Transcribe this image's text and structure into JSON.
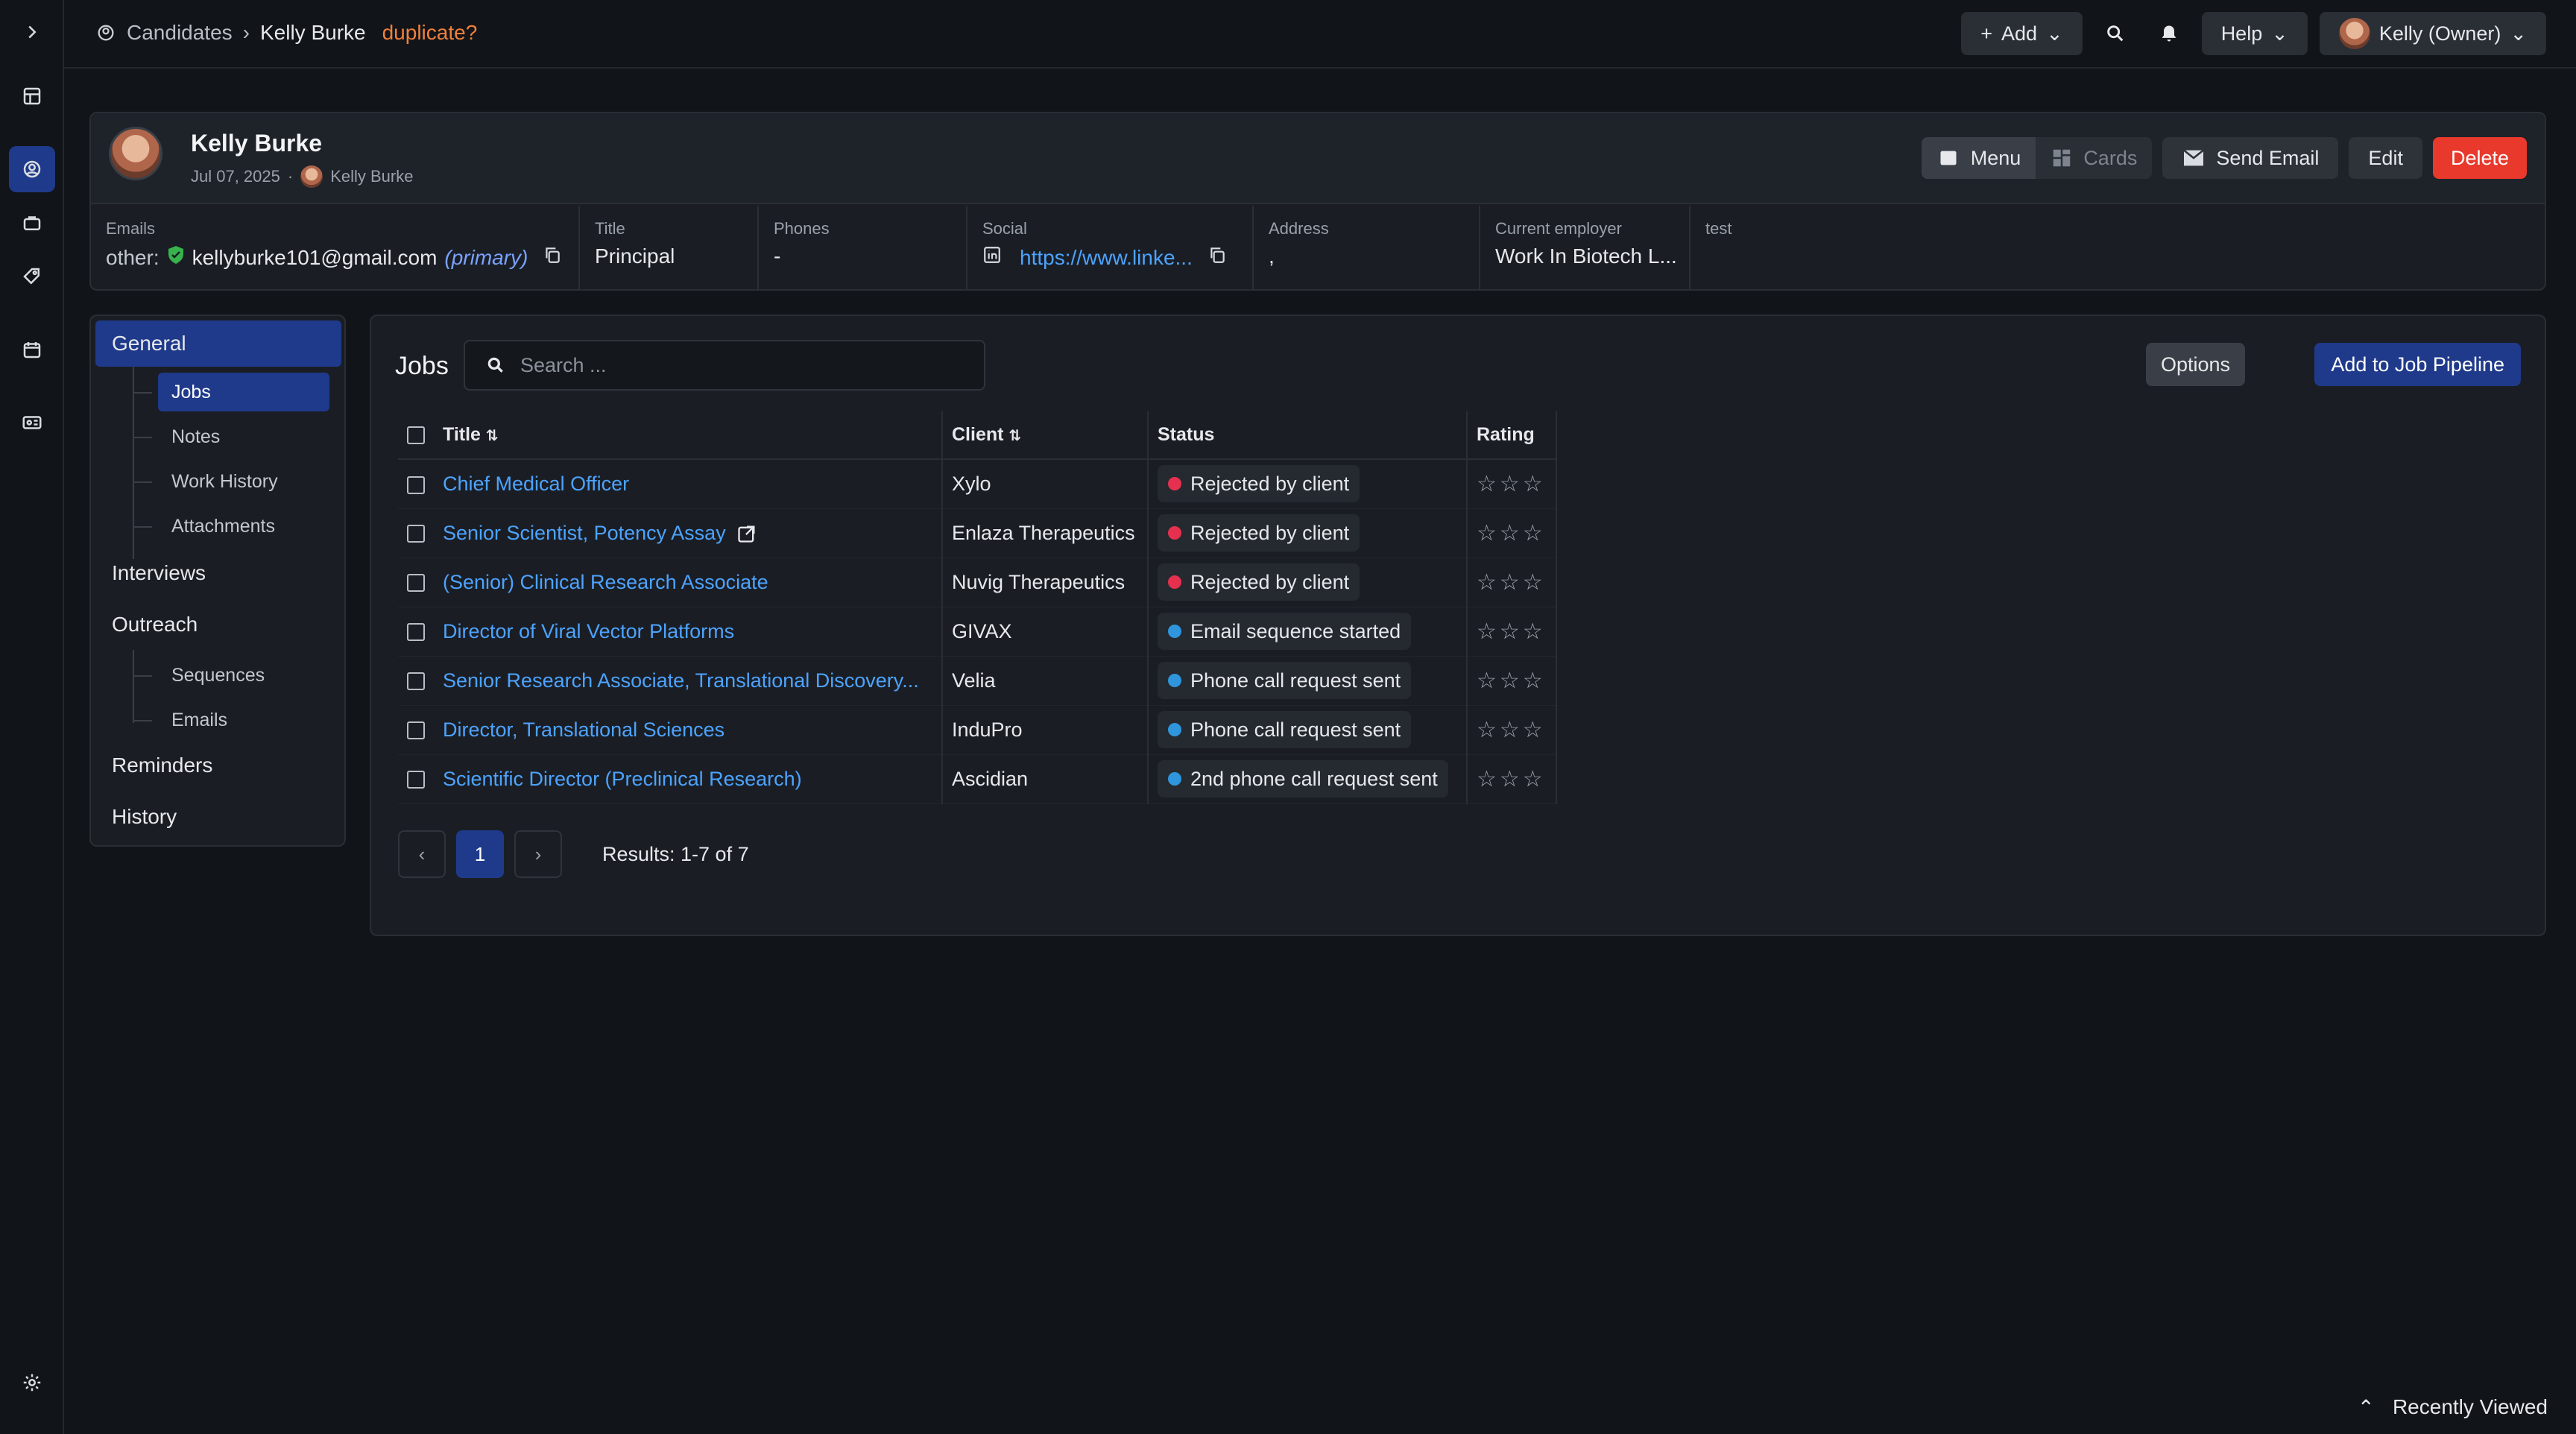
{
  "breadcrumb": {
    "root": "Candidates",
    "current": "Kelly Burke",
    "flag": "duplicate?"
  },
  "topbar": {
    "add_label": "Add",
    "help_label": "Help",
    "user_label": "Kelly (Owner)"
  },
  "candidate": {
    "name": "Kelly Burke",
    "date": "Jul 07, 2025",
    "owner": "Kelly Burke",
    "actions": {
      "menu": "Menu",
      "cards": "Cards",
      "send_email": "Send Email",
      "edit": "Edit",
      "delete": "Delete"
    },
    "fields": {
      "emails": {
        "label": "Emails",
        "prefix": "other:",
        "value": "kellyburke101@gmail.com",
        "tag": "(primary)"
      },
      "title": {
        "label": "Title",
        "value": "Principal"
      },
      "phones": {
        "label": "Phones",
        "value": "-"
      },
      "social": {
        "label": "Social",
        "value": "https://www.linke..."
      },
      "address": {
        "label": "Address",
        "value": ","
      },
      "employer": {
        "label": "Current employer",
        "value": "Work In Biotech L..."
      },
      "custom": {
        "label": "test",
        "value": ""
      }
    }
  },
  "nav": {
    "general": "General",
    "general_subs": [
      "Jobs",
      "Notes",
      "Work History",
      "Attachments"
    ],
    "interviews": "Interviews",
    "outreach": "Outreach",
    "outreach_subs": [
      "Sequences",
      "Emails"
    ],
    "reminders": "Reminders",
    "history": "History"
  },
  "jobs": {
    "title": "Jobs",
    "search_placeholder": "Search ...",
    "options_label": "Options",
    "add_label": "Add to Job Pipeline",
    "columns": {
      "title": "Title",
      "client": "Client",
      "status": "Status",
      "rating": "Rating"
    },
    "rows": [
      {
        "title": "Chief Medical Officer",
        "client": "Xylo",
        "status": "Rejected by client",
        "status_color": "#e5304f",
        "rating": "☆☆☆"
      },
      {
        "title": "Senior Scientist, Potency Assay",
        "client": "Enlaza Therapeutics",
        "status": "Rejected by client",
        "status_color": "#e5304f",
        "rating": "☆☆☆"
      },
      {
        "title": "(Senior) Clinical Research Associate",
        "client": "Nuvig Therapeutics",
        "status": "Rejected by client",
        "status_color": "#e5304f",
        "rating": "☆☆☆"
      },
      {
        "title": "Director of Viral Vector Platforms",
        "client": "GIVAX",
        "status": "Email sequence started",
        "status_color": "#2f95dc",
        "rating": "☆☆☆"
      },
      {
        "title": "Senior Research Associate, Translational Discovery...",
        "client": "Velia",
        "status": "Phone call request sent",
        "status_color": "#2f95dc",
        "rating": "☆☆☆"
      },
      {
        "title": "Director, Translational Sciences",
        "client": "InduPro",
        "status": "Phone call request sent",
        "status_color": "#2f95dc",
        "rating": "☆☆☆"
      },
      {
        "title": "Scientific Director (Preclinical Research)",
        "client": "Ascidian",
        "status": "2nd phone call request sent",
        "status_color": "#2f95dc",
        "rating": "☆☆☆"
      }
    ],
    "pagination": {
      "current_page": "1",
      "prev": "‹",
      "next": "›",
      "results": "Results: 1-7 of 7"
    }
  },
  "footer": {
    "recently_viewed": "Recently Viewed"
  },
  "colors": {
    "accent": "#1f3a8a",
    "danger": "#e8392c",
    "link": "#4da3ff",
    "duplicate": "#f0803c"
  }
}
